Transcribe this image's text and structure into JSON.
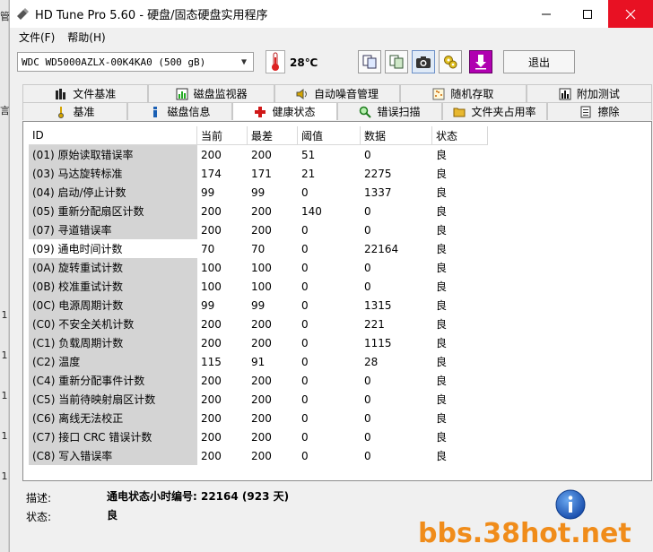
{
  "window": {
    "title": "HD Tune Pro 5.60 - 硬盘/固态硬盘实用程序"
  },
  "left_strip": [
    "管",
    "言",
    "1",
    "1",
    "1",
    "1",
    "1"
  ],
  "menu": [
    {
      "label": "文件(F)"
    },
    {
      "label": "帮助(H)"
    }
  ],
  "toolbar": {
    "drive": "WDC WD5000AZLX-00K4KA0 (500 gB)",
    "temperature": "28℃",
    "exit_label": "退出",
    "buttons": [
      "copy-icon",
      "save-icon",
      "camera-icon",
      "options-icon",
      "download-icon"
    ]
  },
  "tabs_top": [
    {
      "label": "文件基准",
      "icon": "file-benchmark-icon"
    },
    {
      "label": "磁盘监视器",
      "icon": "disk-monitor-icon"
    },
    {
      "label": "自动噪音管理",
      "icon": "speaker-icon"
    },
    {
      "label": "随机存取",
      "icon": "random-access-icon"
    },
    {
      "label": "附加测试",
      "icon": "extra-tests-icon"
    }
  ],
  "tabs_bottom": [
    {
      "label": "基准",
      "icon": "benchmark-icon"
    },
    {
      "label": "磁盘信息",
      "icon": "info-small-icon"
    },
    {
      "label": "健康状态",
      "icon": "health-cross-icon",
      "active": true
    },
    {
      "label": "错误扫描",
      "icon": "magnifier-icon"
    },
    {
      "label": "文件夹占用率",
      "icon": "folder-icon"
    },
    {
      "label": "擦除",
      "icon": "erase-icon"
    }
  ],
  "health": {
    "columns": [
      "ID",
      "当前",
      "最差",
      "阈值",
      "数据",
      "状态"
    ],
    "rows": [
      [
        "(01) 原始读取错误率",
        "200",
        "200",
        "51",
        "0",
        "良"
      ],
      [
        "(03) 马达旋转标准",
        "174",
        "171",
        "21",
        "2275",
        "良"
      ],
      [
        "(04) 启动/停止计数",
        "99",
        "99",
        "0",
        "1337",
        "良"
      ],
      [
        "(05) 重新分配扇区计数",
        "200",
        "200",
        "140",
        "0",
        "良"
      ],
      [
        "(07) 寻道错误率",
        "200",
        "200",
        "0",
        "0",
        "良"
      ],
      [
        "(09) 通电时间计数",
        "70",
        "70",
        "0",
        "22164",
        "良"
      ],
      [
        "(0A) 旋转重试计数",
        "100",
        "100",
        "0",
        "0",
        "良"
      ],
      [
        "(0B) 校准重试计数",
        "100",
        "100",
        "0",
        "0",
        "良"
      ],
      [
        "(0C) 电源周期计数",
        "99",
        "99",
        "0",
        "1315",
        "良"
      ],
      [
        "(C0) 不安全关机计数",
        "200",
        "200",
        "0",
        "221",
        "良"
      ],
      [
        "(C1) 负载周期计数",
        "200",
        "200",
        "0",
        "1115",
        "良"
      ],
      [
        "(C2) 温度",
        "115",
        "91",
        "0",
        "28",
        "良"
      ],
      [
        "(C4) 重新分配事件计数",
        "200",
        "200",
        "0",
        "0",
        "良"
      ],
      [
        "(C5) 当前待映射扇区计数",
        "200",
        "200",
        "0",
        "0",
        "良"
      ],
      [
        "(C6) 离线无法校正",
        "200",
        "200",
        "0",
        "0",
        "良"
      ],
      [
        "(C7) 接口 CRC 错误计数",
        "200",
        "200",
        "0",
        "0",
        "良"
      ],
      [
        "(C8) 写入错误率",
        "200",
        "200",
        "0",
        "0",
        "良"
      ]
    ],
    "selected_row": 5
  },
  "description": {
    "desc_label": "描述:",
    "desc_value": "通电状态小时编号: 22164 (923 天)",
    "status_label": "状态:",
    "status_value": "良"
  },
  "watermark": "bbs.38hot.net",
  "colors": {
    "close_button": "#e81123",
    "watermark": "#f08c1a",
    "id_column": "#d4d4d4"
  }
}
